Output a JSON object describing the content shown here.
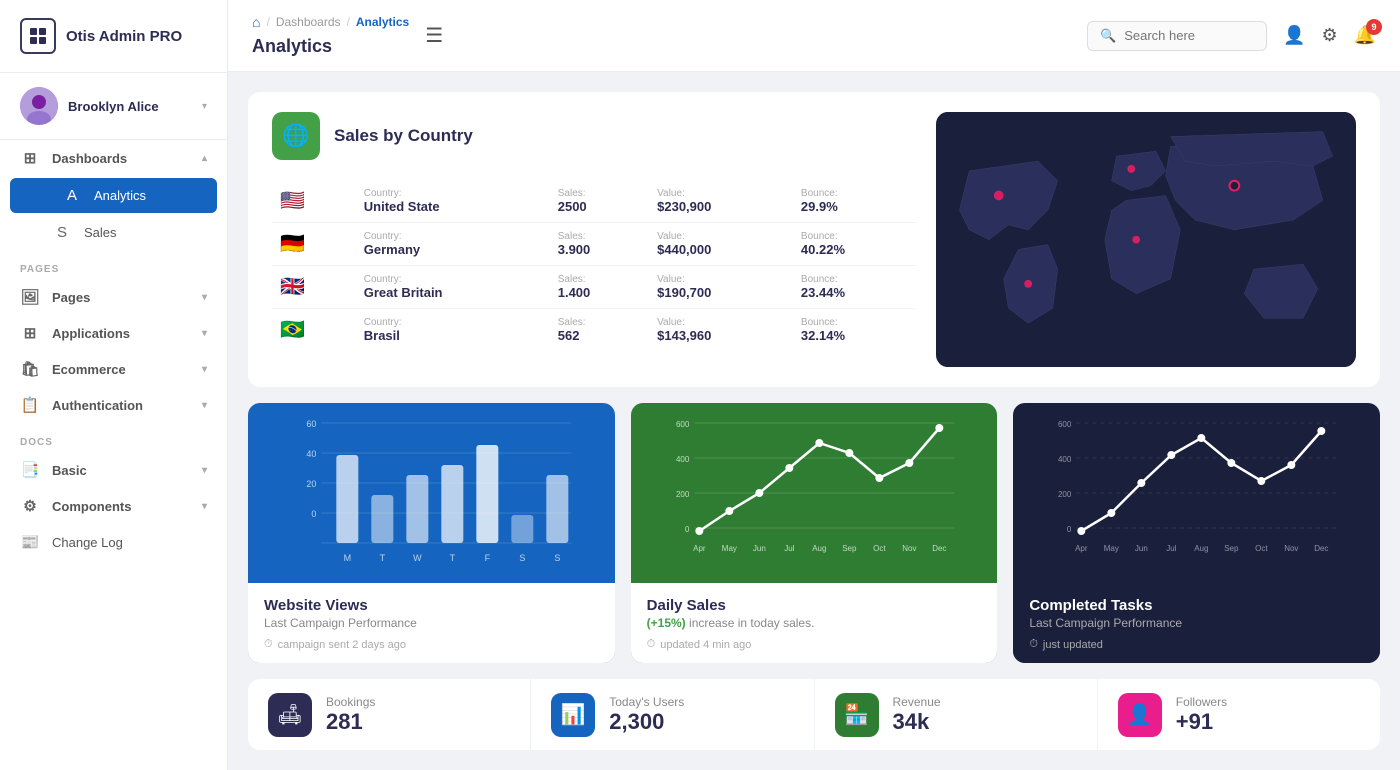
{
  "sidebar": {
    "logo_text": "Otis Admin PRO",
    "user_name": "Brooklyn Alice",
    "dashboards_label": "Dashboards",
    "analytics_label": "Analytics",
    "sales_label": "Sales",
    "pages_section": "PAGES",
    "pages_label": "Pages",
    "applications_label": "Applications",
    "ecommerce_label": "Ecommerce",
    "authentication_label": "Authentication",
    "docs_section": "DOCS",
    "basic_label": "Basic",
    "components_label": "Components",
    "changelog_label": "Change Log"
  },
  "header": {
    "home_icon": "⌂",
    "breadcrumb_dash": "Dashboards",
    "breadcrumb_analytics": "Analytics",
    "page_title": "Analytics",
    "search_placeholder": "Search here",
    "notif_count": "9"
  },
  "sales_country": {
    "title": "Sales by Country",
    "columns": {
      "country": "Country:",
      "sales": "Sales:",
      "value": "Value:",
      "bounce": "Bounce:"
    },
    "rows": [
      {
        "flag": "🇺🇸",
        "country": "United State",
        "sales": "2500",
        "value": "$230,900",
        "bounce": "29.9%"
      },
      {
        "flag": "🇩🇪",
        "country": "Germany",
        "sales": "3.900",
        "value": "$440,000",
        "bounce": "40.22%"
      },
      {
        "flag": "🇬🇧",
        "country": "Great Britain",
        "sales": "1.400",
        "value": "$190,700",
        "bounce": "23.44%"
      },
      {
        "flag": "🇧🇷",
        "country": "Brasil",
        "sales": "562",
        "value": "$143,960",
        "bounce": "32.14%"
      }
    ]
  },
  "website_views": {
    "title": "Website Views",
    "subtitle": "Last Campaign Performance",
    "time_label": "campaign sent 2 days ago",
    "y_labels": [
      "60",
      "40",
      "20",
      "0"
    ],
    "x_labels": [
      "M",
      "T",
      "W",
      "T",
      "F",
      "S",
      "S"
    ],
    "bars": [
      55,
      25,
      40,
      50,
      65,
      15,
      45
    ]
  },
  "daily_sales": {
    "title": "Daily Sales",
    "subtitle_highlight": "(+15%)",
    "subtitle_rest": "increase in today sales.",
    "time_label": "updated 4 min ago",
    "y_labels": [
      "600",
      "400",
      "200",
      "0"
    ],
    "x_labels": [
      "Apr",
      "May",
      "Jun",
      "Jul",
      "Aug",
      "Sep",
      "Oct",
      "Nov",
      "Dec"
    ],
    "points": [
      10,
      80,
      200,
      350,
      480,
      420,
      280,
      350,
      520
    ]
  },
  "completed_tasks": {
    "title": "Completed Tasks",
    "subtitle": "Last Campaign Performance",
    "time_label": "just updated",
    "y_labels": [
      "600",
      "400",
      "200",
      "0"
    ],
    "x_labels": [
      "Apr",
      "May",
      "Jun",
      "Jul",
      "Aug",
      "Sep",
      "Oct",
      "Nov",
      "Dec"
    ],
    "points": [
      20,
      120,
      280,
      400,
      500,
      380,
      300,
      350,
      520
    ]
  },
  "stats": [
    {
      "icon": "🛋",
      "icon_class": "stat-icon-dark",
      "label": "Bookings",
      "value": "281"
    },
    {
      "icon": "📊",
      "icon_class": "stat-icon-blue",
      "label": "Today's Users",
      "value": "2,300"
    },
    {
      "icon": "🏪",
      "icon_class": "stat-icon-green",
      "label": "Revenue",
      "value": "34k"
    },
    {
      "icon": "👤",
      "icon_class": "stat-icon-pink",
      "label": "Followers",
      "value": "+91"
    }
  ]
}
